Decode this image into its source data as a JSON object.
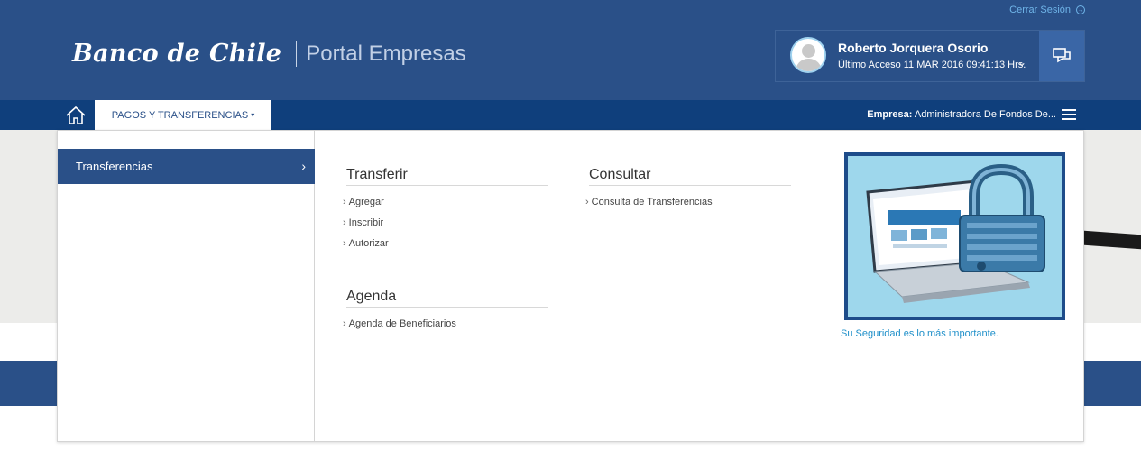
{
  "header": {
    "logout_label": "Cerrar Sesión",
    "brand_logo": "Banco de Chile",
    "brand_portal": "Portal Empresas",
    "user_name": "Roberto Jorquera Osorio",
    "user_last_access": "Último Acceso 11 MAR 2016 09:41:13 Hrs."
  },
  "navbar": {
    "tab_label": "PAGOS Y TRANSFERENCIAS",
    "company_label": "Empresa:",
    "company_value": "Administradora De Fondos De..."
  },
  "menu": {
    "left_item": "Transferencias",
    "sections": [
      {
        "title": "Transferir",
        "links": [
          "Agregar",
          "Inscribir",
          "Autorizar"
        ]
      },
      {
        "title": "Consultar",
        "links": [
          "Consulta de Transferencias"
        ]
      },
      {
        "title": "Agenda",
        "links": [
          "Agenda de Beneficiarios"
        ]
      }
    ],
    "promo_caption": "Su Seguridad es lo más importante."
  },
  "colors": {
    "header_bg": "#2a5088",
    "navbar_bg": "#0f3f7c",
    "accent_link": "#1e8fc9"
  },
  "icons": [
    "logout-icon",
    "user-avatar-icon",
    "chat-icon",
    "home-icon",
    "chevron-down-icon",
    "hamburger-menu-icon",
    "chevron-right-icon"
  ]
}
